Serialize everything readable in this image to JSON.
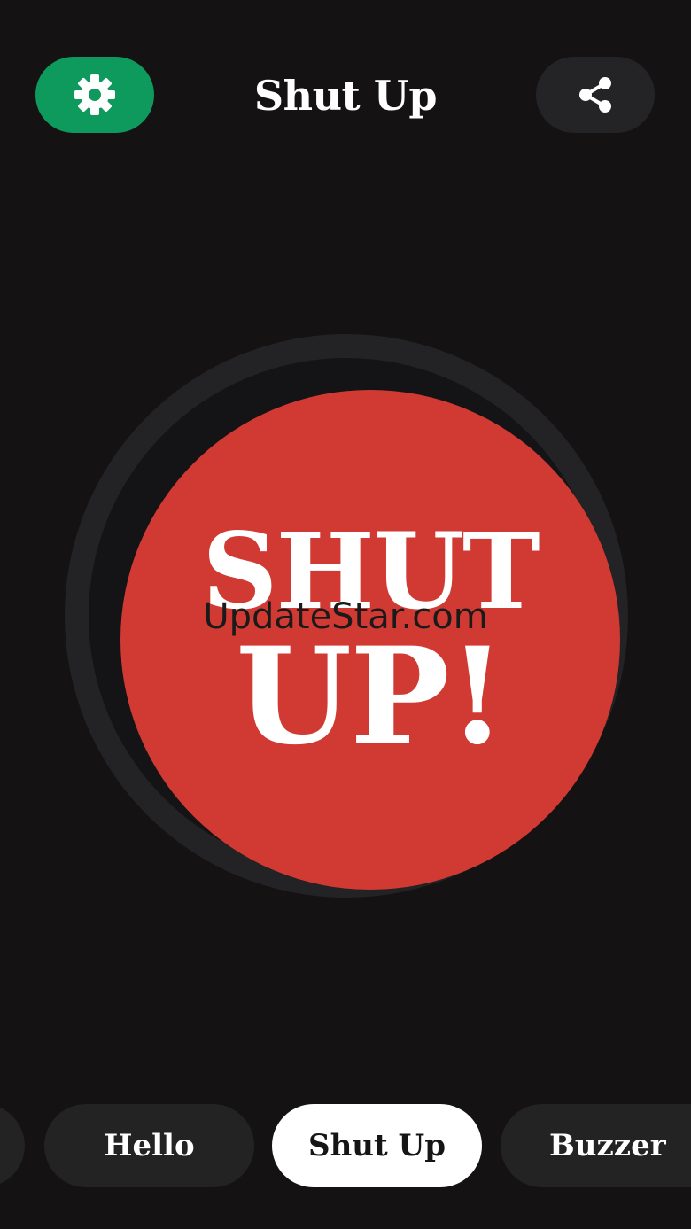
{
  "header": {
    "title": "Shut Up",
    "settings_icon": "gear-icon",
    "share_icon": "share-icon"
  },
  "main_button": {
    "line1": "SHUT",
    "line2": "UP!"
  },
  "watermark": "UpdateStar.com",
  "tabs": [
    {
      "label": ""
    },
    {
      "label": "Hello"
    },
    {
      "label": "Shut Up",
      "selected": true
    },
    {
      "label": "Buzzer"
    }
  ],
  "colors": {
    "background": "#141212",
    "settings_button": "#0e9a5c",
    "share_button": "#242326",
    "big_button_red": "#d13a33",
    "tab_bg": "#232324",
    "tab_selected_bg": "#ffffff"
  }
}
